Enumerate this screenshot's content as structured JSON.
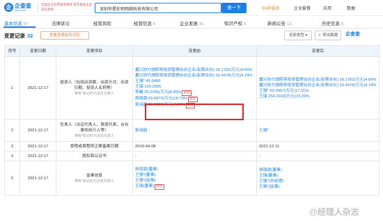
{
  "header": {
    "logo_glyph": "企",
    "logo_name": "企查查",
    "logo_domain": "Qcc.com",
    "slogan": "全国企业信用查询系统 官方备案企业征信机构",
    "search_value": "深圳市星彩积网络科技有限公司",
    "search_button": "查一下",
    "links": [
      "SVIP会员",
      "企业套餐",
      "应用",
      "数据"
    ]
  },
  "tabs": [
    {
      "label": "基本信息",
      "count": "57"
    },
    {
      "label": "法律诉讼",
      "count": ""
    },
    {
      "label": "经营风险",
      "count": ""
    },
    {
      "label": "经营信息",
      "count": "8"
    },
    {
      "label": "企业发展",
      "count": "31"
    },
    {
      "label": "知识产权",
      "count": "8"
    },
    {
      "label": "新闻公告",
      "count": "13"
    },
    {
      "label": "历史信息",
      "count": "8"
    }
  ],
  "section": {
    "title": "变更记录",
    "count": "32",
    "badge": "查看变更前后对比",
    "filter_label": "全部类型",
    "export_label": "导出数据",
    "brand": "企查查"
  },
  "table": {
    "headers": [
      "序号",
      "变更日期",
      "变更项目",
      "变更前",
      "变更后"
    ],
    "rows": [
      {
        "no": "1",
        "date": "2021-12-17",
        "item": "投资人（包括出资额、出资方式、出资日期、投资人名称等）",
        "item_note": "带有*标记的为法定代表人",
        "before": [
          "嘉兴协力驰陌导投资管理合伙企业(有限合伙) 16.1702(万元)4.66%",
          "嘉兴协力驰陌导投资管理合伙企业(有限合伙) 16.4478(万元)4.74%",
          "王强* 45.0406",
          "王瑞 159.2036",
          "李襄 30.0155(万元)8.65%【退出】",
          "胡海恩 65.0972(万元)18.70%【退出】",
          "郭诗韵 15.0251(万元)4.33%【退出】"
        ],
        "after": [
          "嘉兴协力驰陌导投资管理合伙企业(有限合伙) 16.1702(万元)4.66%",
          "嘉兴协力驰陌导投资管理合伙企业(有限合伙) 16.4478(万元)4.74%",
          "王强* 60.0657(万元)17.31%",
          "王瑞 254.3163(万元)73.29%"
        ]
      },
      {
        "no": "2",
        "date": "2021-12-17",
        "item": "负责人（法定代表人、首席代表、合伙事务执行人等）",
        "item_note": "带有*标记的为法定代表人",
        "before": [
          "郭诗韵"
        ],
        "after": [
          "王强*"
        ]
      },
      {
        "no": "3",
        "date": "2021-12-17",
        "item": "章程或章程修正案备案日期",
        "item_note": "",
        "before": [
          "2019-04-08"
        ],
        "after": [
          "2021-12-11"
        ]
      },
      {
        "no": "4",
        "date": "2021-12-17",
        "item": "股权和公证书",
        "item_note": "",
        "before": [
          "-"
        ],
        "after": [
          "-"
        ]
      },
      {
        "no": "5",
        "date": "2021-12-17",
        "item": "监事信息",
        "item_note": "带有*标记的为法定代表人",
        "before": [
          "胡海恩(董事)",
          "王强*(董事)",
          "王强*(监事)",
          "王瑞(董事)【退出】"
        ],
        "after": [
          "胡海恩(董事)",
          "王瑞(董事)",
          "王强*(总经理)",
          "王强*(监事)"
        ]
      }
    ]
  },
  "watermark": "@经理人杂志"
}
